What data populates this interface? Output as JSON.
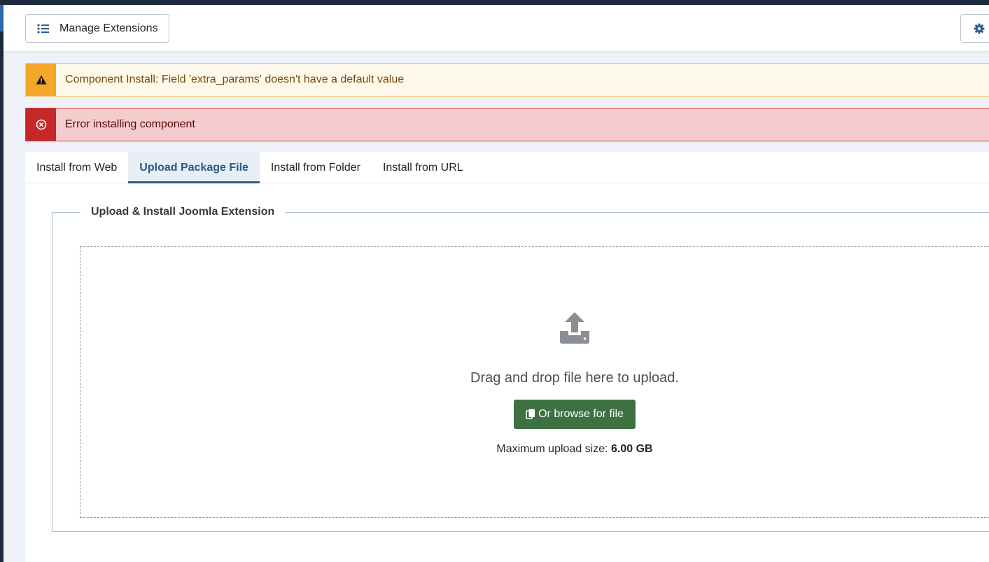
{
  "toolbar": {
    "manage_label": "Manage Extensions",
    "options_icon": "gear-icon"
  },
  "alerts": {
    "warning": {
      "message": "Component Install: Field 'extra_params' doesn't have a default value",
      "icon": "warning-triangle-icon"
    },
    "error": {
      "message": "Error installing component",
      "icon": "circle-x-icon"
    }
  },
  "tabs": [
    {
      "label": "Install from Web"
    },
    {
      "label": "Upload Package File",
      "active": true
    },
    {
      "label": "Install from Folder"
    },
    {
      "label": "Install from URL"
    }
  ],
  "upload": {
    "legend": "Upload & Install Joomla Extension",
    "drag_text": "Drag and drop file here to upload.",
    "browse_label": "Or browse for file",
    "max_size_label": "Maximum upload size:",
    "max_size_value": "6.00 GB"
  },
  "colors": {
    "warning_accent": "#f5a72b",
    "error_accent": "#c52827",
    "active_tab": "#2a5a8c",
    "browse_button": "#3d7141"
  }
}
